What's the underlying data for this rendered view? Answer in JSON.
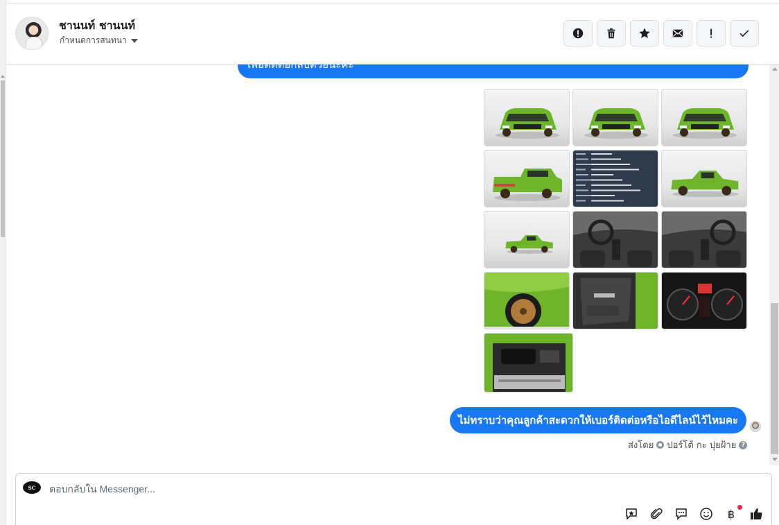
{
  "header": {
    "contact_name": "ชานนท์ ชานนท์",
    "assign_label": "กำหนดการสนทนา",
    "actions": [
      {
        "name": "report-icon"
      },
      {
        "name": "trash-icon"
      },
      {
        "name": "star-icon"
      },
      {
        "name": "mail-icon"
      },
      {
        "name": "exclamation-icon"
      },
      {
        "name": "check-icon"
      }
    ]
  },
  "messages": {
    "top_partial": "เพื่อติดต่อกลับด้วยนะคะ",
    "gallery": [
      {
        "name": "car-front-34",
        "kind": "car-front"
      },
      {
        "name": "car-front",
        "kind": "car-front"
      },
      {
        "name": "car-front-34-b",
        "kind": "car-front"
      },
      {
        "name": "car-rear",
        "kind": "car-rear"
      },
      {
        "name": "spec-sheet",
        "kind": "spec"
      },
      {
        "name": "car-side",
        "kind": "car-side"
      },
      {
        "name": "car-side-far",
        "kind": "car-side"
      },
      {
        "name": "gear-shift",
        "kind": "interior"
      },
      {
        "name": "dashboard",
        "kind": "interior"
      },
      {
        "name": "wheel",
        "kind": "wheel"
      },
      {
        "name": "door-panel",
        "kind": "door"
      },
      {
        "name": "gauge-cluster",
        "kind": "gauge"
      },
      {
        "name": "engine-bay",
        "kind": "engine"
      }
    ],
    "main_text": "ไม่ทราบว่าคุณลูกค้าสะดวกให้เบอร์ติดต่อหรือไอดีไลน์ไว้ไหมคะ",
    "sent_by_label": "ส่งโดย",
    "sender_name": "ปอร์โต้ กะ ปุยฝ้าย",
    "help_glyph": "?"
  },
  "composer": {
    "placeholder": "ตอบกลับใน Messenger...",
    "page_logo_text": "SC",
    "currency_glyph": "฿"
  },
  "colors": {
    "accent": "#1877f2",
    "body_green": "#6fb52c",
    "badge": "#f02849"
  }
}
